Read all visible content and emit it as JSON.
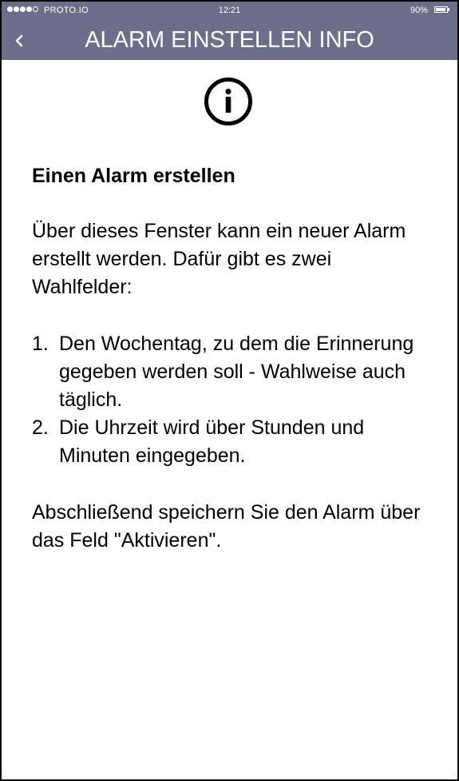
{
  "status_bar": {
    "carrier": "PROTO.IO",
    "time": "12:21",
    "battery": "90%",
    "battery_level": 0.9,
    "signal_bars_filled": 4,
    "signal_bars_total": 5
  },
  "header": {
    "title": "ALARM EINSTELLEN INFO",
    "back_icon": "chevron-left-icon"
  },
  "content": {
    "icon": "info-icon",
    "heading": "Einen Alarm erstellen",
    "intro": "Über dieses Fenster kann ein neuer Alarm erstellt werden. Dafür gibt es zwei Wahlfelder:",
    "steps": [
      {
        "number": "1.",
        "text": "Den Wochentag, zu dem die Erinnerung gegeben werden soll - Wahlweise auch täglich."
      },
      {
        "number": "2.",
        "text": "Die Uhrzeit wird über Stunden und Minuten eingegeben."
      }
    ],
    "closing": "Abschließend speichern Sie den Alarm über das Feld \"Aktivieren\"."
  },
  "colors": {
    "header_bg": "#6b6f89",
    "header_text": "#ffffff",
    "body_text": "#000000"
  }
}
